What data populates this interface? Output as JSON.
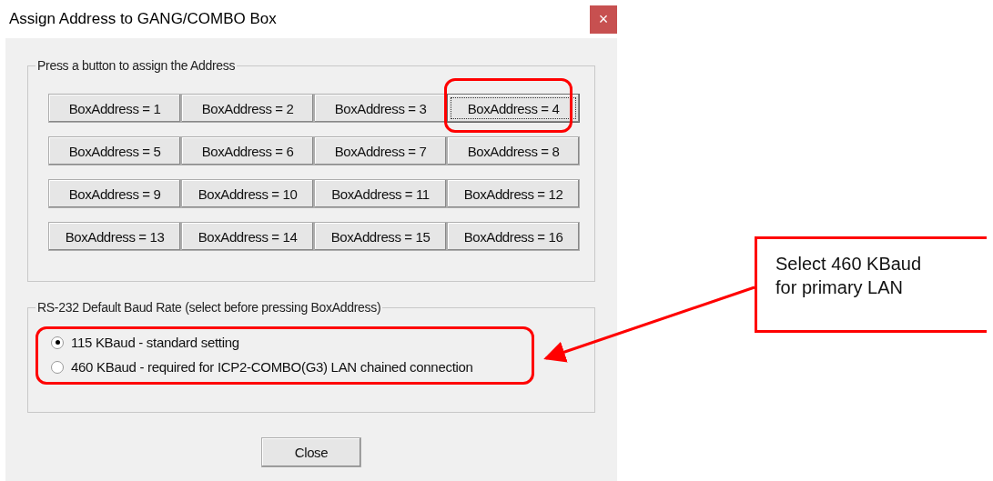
{
  "window": {
    "title": "Assign Address to GANG/COMBO Box",
    "close": "×"
  },
  "address_group": {
    "title": "Press a button to assign the Address",
    "buttons": [
      {
        "label": "BoxAddress = 1",
        "focused": false,
        "highlighted": false
      },
      {
        "label": "BoxAddress = 2",
        "focused": false,
        "highlighted": false
      },
      {
        "label": "BoxAddress = 3",
        "focused": false,
        "highlighted": false
      },
      {
        "label": "BoxAddress = 4",
        "focused": true,
        "highlighted": true
      },
      {
        "label": "BoxAddress = 5",
        "focused": false,
        "highlighted": false
      },
      {
        "label": "BoxAddress = 6",
        "focused": false,
        "highlighted": false
      },
      {
        "label": "BoxAddress = 7",
        "focused": false,
        "highlighted": false
      },
      {
        "label": "BoxAddress = 8",
        "focused": false,
        "highlighted": false
      },
      {
        "label": "BoxAddress = 9",
        "focused": false,
        "highlighted": false
      },
      {
        "label": "BoxAddress = 10",
        "focused": false,
        "highlighted": false
      },
      {
        "label": "BoxAddress = 11",
        "focused": false,
        "highlighted": false
      },
      {
        "label": "BoxAddress = 12",
        "focused": false,
        "highlighted": false
      },
      {
        "label": "BoxAddress = 13",
        "focused": false,
        "highlighted": false
      },
      {
        "label": "BoxAddress = 14",
        "focused": false,
        "highlighted": false
      },
      {
        "label": "BoxAddress = 15",
        "focused": false,
        "highlighted": false
      },
      {
        "label": "BoxAddress = 16",
        "focused": false,
        "highlighted": false
      }
    ]
  },
  "baud_group": {
    "title": "RS-232 Default Baud Rate (select before pressing BoxAddress)",
    "highlighted": true,
    "options": [
      {
        "label": "115 KBaud - standard setting",
        "selected": true
      },
      {
        "label": "460 KBaud - required for ICP2-COMBO(G3) LAN chained connection",
        "selected": false
      }
    ]
  },
  "close_button": "Close",
  "callout": {
    "text": "Select 460 KBaud\nfor primary LAN"
  }
}
